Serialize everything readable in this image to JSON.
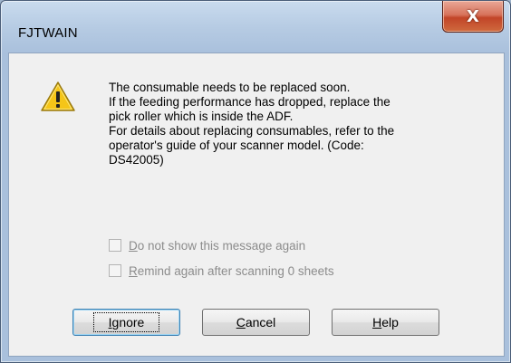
{
  "window": {
    "title": "FJTWAIN",
    "close_glyph": "X"
  },
  "icon": {
    "name": "warning-icon",
    "color": "#f5c518"
  },
  "message": {
    "lines": [
      "The consumable needs to be replaced soon.",
      "If the feeding performance has dropped, replace the",
      "pick roller which is inside the ADF.",
      "For details about replacing consumables, refer to the",
      "operator's guide of your scanner model.  (Code:",
      "DS42005)"
    ]
  },
  "options": {
    "do_not_show": {
      "accel": "D",
      "rest": "o not show this message again",
      "checked": false,
      "enabled": false
    },
    "remind_again": {
      "accel": "R",
      "rest": "emind again after scanning 0 sheets",
      "checked": false,
      "enabled": false
    }
  },
  "buttons": {
    "ignore": {
      "accel": "I",
      "rest": "gnore"
    },
    "cancel": {
      "accel": "C",
      "rest": "ancel"
    },
    "help": {
      "accel": "H",
      "rest": "elp"
    }
  }
}
